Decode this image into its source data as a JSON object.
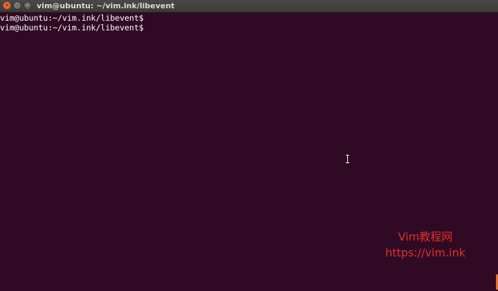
{
  "window": {
    "title": "vim@ubuntu: ~/vim.ink/libevent",
    "controls": {
      "close_glyph": "×",
      "minimize_glyph": "–",
      "maximize_glyph": "□"
    }
  },
  "terminal": {
    "lines": [
      "vim@ubuntu:~/vim.ink/libevent$",
      "vim@ubuntu:~/vim.ink/libevent$"
    ]
  },
  "watermark": {
    "line1": "Vim教程网",
    "line2": "https://vim.ink"
  },
  "colors": {
    "terminal_background": "#300a24",
    "titlebar": "#3c3b37",
    "text": "#ffffff",
    "watermark": "#e0302a",
    "close_button": "#e0501f"
  },
  "icons": {
    "close": "close-icon",
    "minimize": "minimize-icon",
    "maximize": "maximize-icon",
    "cursor": "ibeam-cursor-icon"
  }
}
